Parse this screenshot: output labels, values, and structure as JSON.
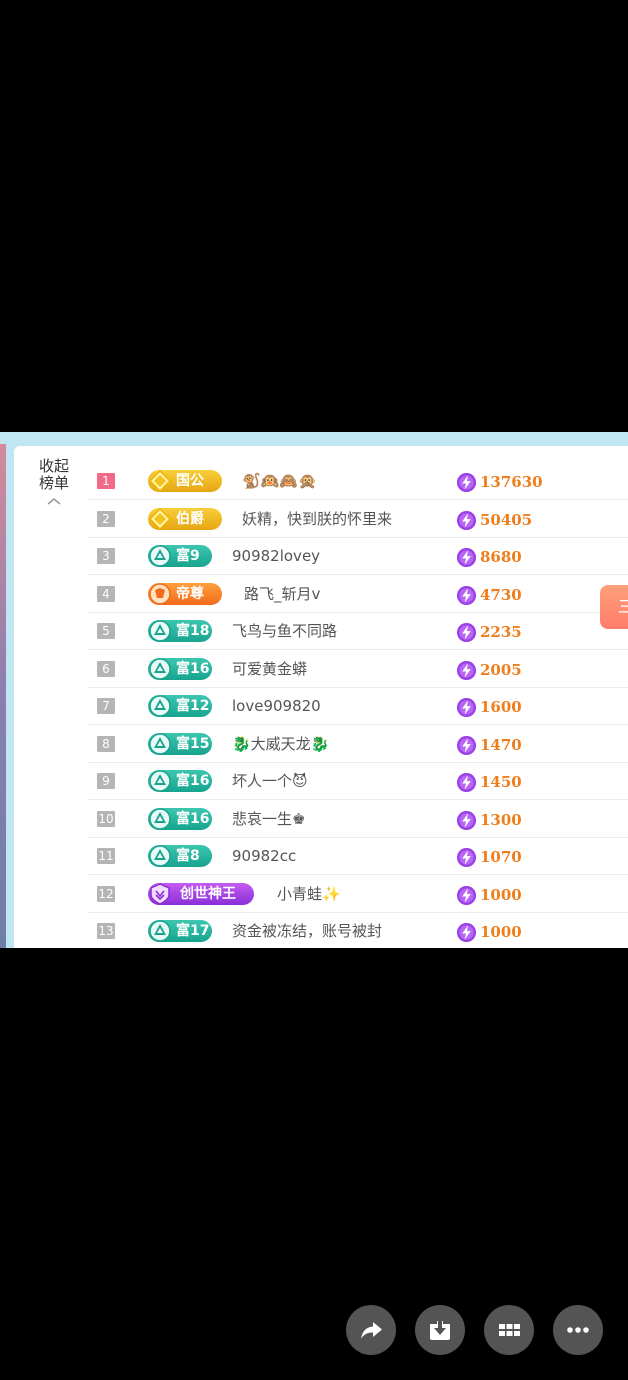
{
  "collapse": {
    "line1": "收起",
    "line2": "榜单"
  },
  "side_tab_label": "三",
  "colors": {
    "score": "#ef7d1a",
    "rank_first": "#f26a88",
    "rank_default": "#b5b5b5",
    "panel_bg": "#bfe6f2"
  },
  "rows": [
    {
      "rank": "1",
      "badge": "国公",
      "badge_style": "gold",
      "name": "🐒🙉🙈🙊",
      "score": "137630"
    },
    {
      "rank": "2",
      "badge": "伯爵",
      "badge_style": "gold",
      "name": "妖精，快到朕的怀里来",
      "score": "50405"
    },
    {
      "rank": "3",
      "badge": "富9",
      "badge_style": "teal",
      "name": "90982lovey",
      "score": "8680"
    },
    {
      "rank": "4",
      "badge": "帝尊",
      "badge_style": "orange",
      "name": "路飞_斩月v",
      "score": "4730"
    },
    {
      "rank": "5",
      "badge": "富18",
      "badge_style": "teal",
      "name": "飞鸟与鱼不同路",
      "score": "2235"
    },
    {
      "rank": "6",
      "badge": "富16",
      "badge_style": "teal",
      "name": "可爱黄金蟒",
      "score": "2005"
    },
    {
      "rank": "7",
      "badge": "富12",
      "badge_style": "teal",
      "name": "love909820",
      "score": "1600"
    },
    {
      "rank": "8",
      "badge": "富15",
      "badge_style": "teal",
      "name": "🐉大威天龙🐉",
      "score": "1470"
    },
    {
      "rank": "9",
      "badge": "富16",
      "badge_style": "teal",
      "name": "坏人一个😈",
      "score": "1450"
    },
    {
      "rank": "10",
      "badge": "富16",
      "badge_style": "teal",
      "name": "悲哀一生♚",
      "score": "1300"
    },
    {
      "rank": "11",
      "badge": "富8",
      "badge_style": "teal",
      "name": "90982cc",
      "score": "1070"
    },
    {
      "rank": "12",
      "badge": "创世神王",
      "badge_style": "purple",
      "name": "小青蛙✨",
      "score": "1000"
    },
    {
      "rank": "13",
      "badge": "富17",
      "badge_style": "teal",
      "name": "资金被冻结，账号被封",
      "score": "1000"
    }
  ],
  "bottom_actions": [
    {
      "icon": "share-icon"
    },
    {
      "icon": "download-icon"
    },
    {
      "icon": "apps-grid-icon"
    },
    {
      "icon": "more-icon"
    }
  ]
}
